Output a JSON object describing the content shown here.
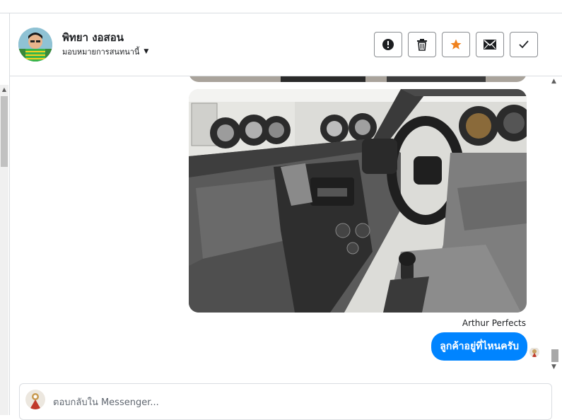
{
  "contact": {
    "name": "พิทยา งอสอน",
    "assign_label": "มอบหมายการสนทนานี้"
  },
  "actions": {
    "spam": "exclamation-icon",
    "delete": "trash-icon",
    "star": "star-icon",
    "unread": "envelope-icon",
    "done": "check-icon",
    "star_color": "#f0821e"
  },
  "messages": {
    "sender_name": "Arthur Perfects",
    "last_message": "ลูกค้าอยู่ที่ไหนครับ",
    "bubble_color": "#0084ff"
  },
  "reply": {
    "placeholder": "ตอบกลับใน Messenger..."
  }
}
